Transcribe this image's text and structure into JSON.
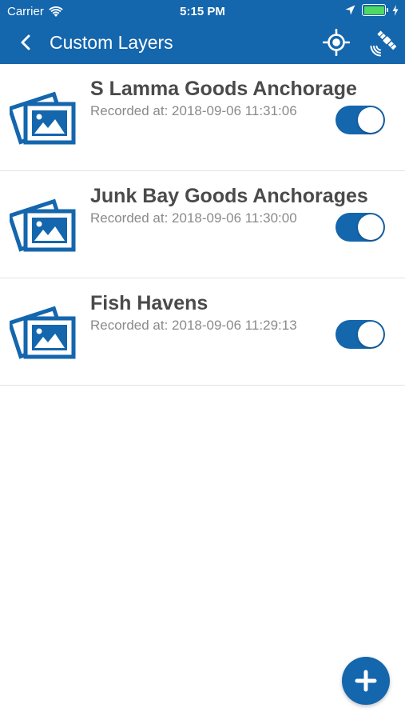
{
  "status_bar": {
    "carrier": "Carrier",
    "time": "5:15 PM",
    "icons": [
      "wifi-icon",
      "location-arrow-icon",
      "battery-icon",
      "charging-icon"
    ]
  },
  "nav": {
    "title": "Custom Layers",
    "back_icon": "chevron-left-icon",
    "locate_icon": "crosshair-icon",
    "satellite_icon": "satellite-icon"
  },
  "layers": [
    {
      "title": "S Lamma Goods Anchorage",
      "recorded": "Recorded at: 2018-09-06 11:31:06",
      "enabled": true,
      "icon": "image-stack-icon"
    },
    {
      "title": "Junk Bay Goods Anchorages",
      "recorded": "Recorded at: 2018-09-06 11:30:00",
      "enabled": true,
      "icon": "image-stack-icon"
    },
    {
      "title": "Fish Havens",
      "recorded": "Recorded at: 2018-09-06 11:29:13",
      "enabled": true,
      "icon": "image-stack-icon"
    }
  ],
  "fab": {
    "icon": "plus-icon"
  },
  "colors": {
    "primary": "#1466ad",
    "title_text": "#4a4a4a",
    "subtitle_text": "#8a8a8a",
    "battery": "#4cd964"
  }
}
